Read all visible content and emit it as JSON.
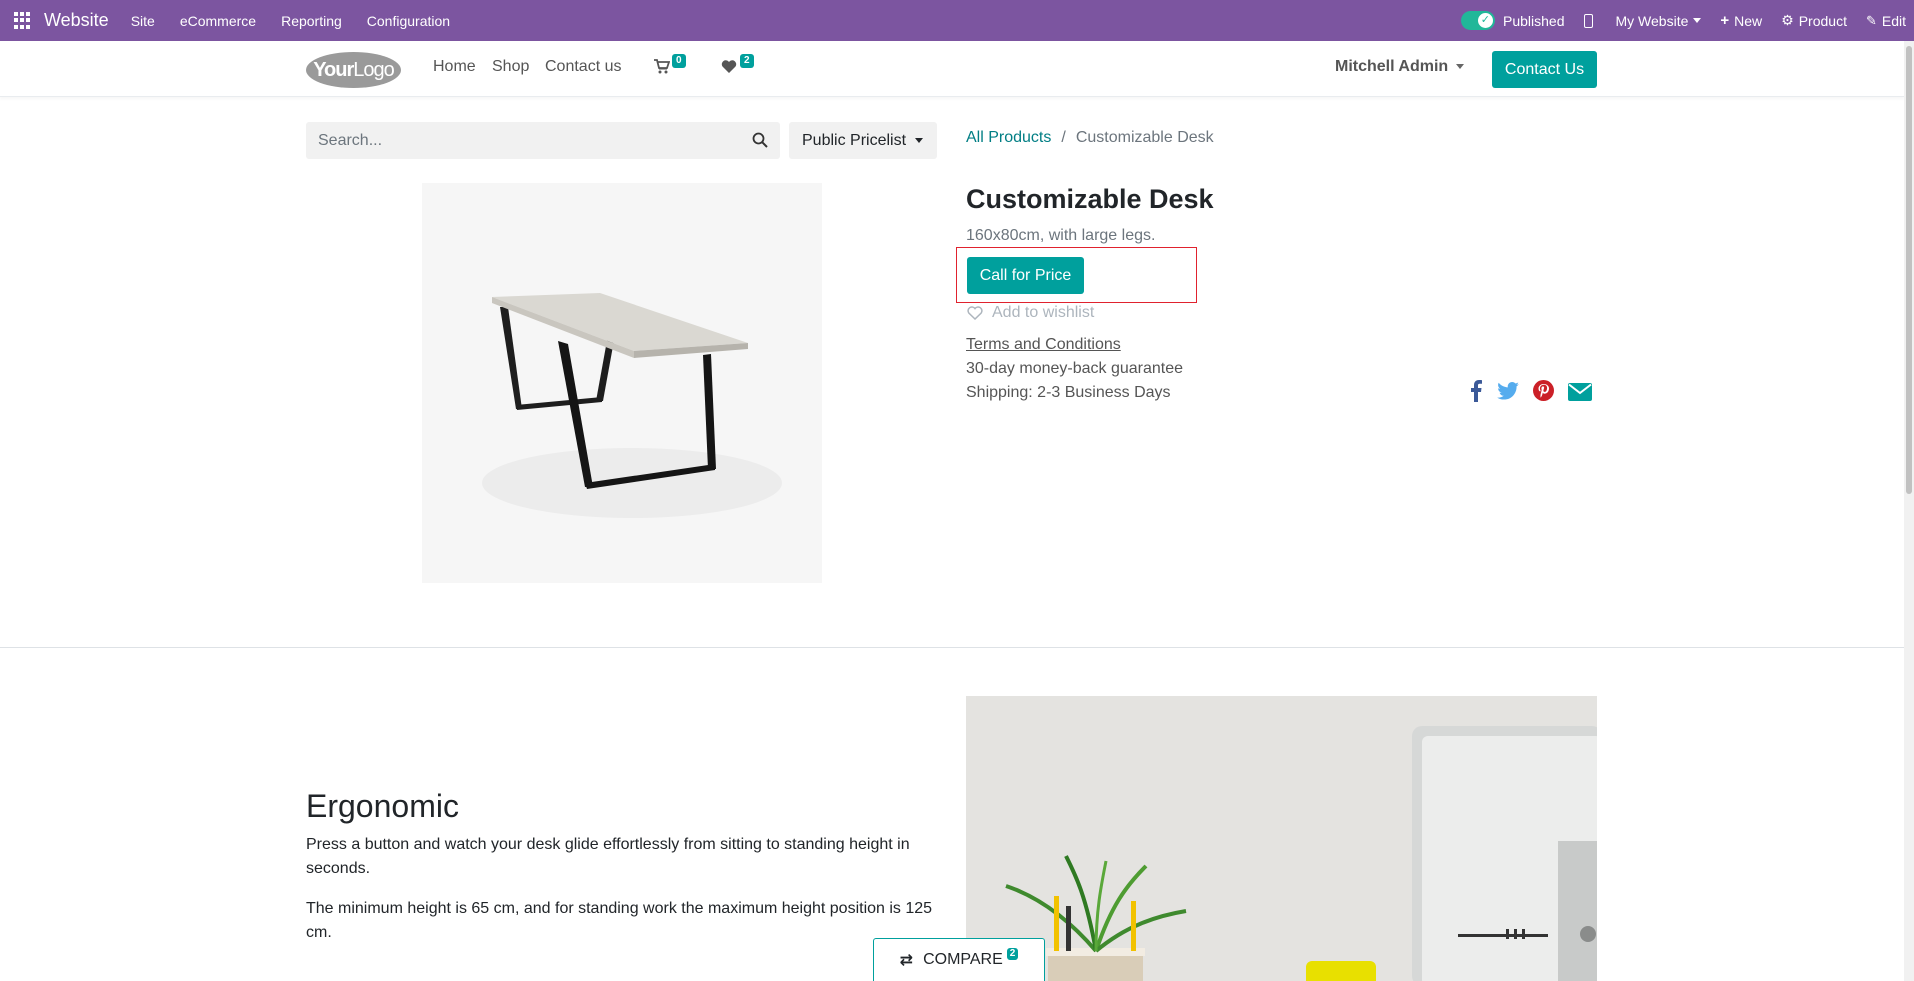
{
  "adminbar": {
    "app_name": "Website",
    "menu": [
      "Site",
      "eCommerce",
      "Reporting",
      "Configuration"
    ],
    "published_label": "Published",
    "website_label": "My Website",
    "new_label": "New",
    "product_label": "Product",
    "edit_label": "Edit"
  },
  "header": {
    "logo_text_bold": "Your",
    "logo_text": "Logo",
    "nav": [
      "Home",
      "Shop",
      "Contact us"
    ],
    "cart_count": "0",
    "wishlist_count": "2",
    "user": "Mitchell Admin",
    "contact_button": "Contact Us"
  },
  "search": {
    "placeholder": "Search..."
  },
  "pricelist": {
    "label": "Public Pricelist"
  },
  "breadcrumb": {
    "parent": "All Products",
    "current": "Customizable Desk"
  },
  "product": {
    "name": "Customizable Desk",
    "description": "160x80cm, with large legs.",
    "call_button": "Call for Price",
    "wishlist_label": "Add to wishlist",
    "terms": "Terms and Conditions",
    "guarantee": "30-day money-back guarantee",
    "shipping": "Shipping: 2-3 Business Days"
  },
  "share": {
    "icons": [
      "facebook-icon",
      "twitter-icon",
      "pinterest-icon",
      "email-icon"
    ],
    "colors": {
      "facebook": "#3b5998",
      "twitter": "#55acee",
      "pinterest": "#cb2027",
      "email": "#00a09d"
    }
  },
  "ergonomic": {
    "title": "Ergonomic",
    "p1": "Press a button and watch your desk glide effortlessly from sitting to standing height in seconds.",
    "p2": "The minimum height is 65 cm, and for standing work the maximum height position is 125 cm."
  },
  "compare": {
    "label": "COMPARE",
    "count": "2"
  },
  "colors": {
    "admin_bar": "#7c55a0",
    "primary": "#00a09d",
    "highlight": "#e0222e"
  }
}
